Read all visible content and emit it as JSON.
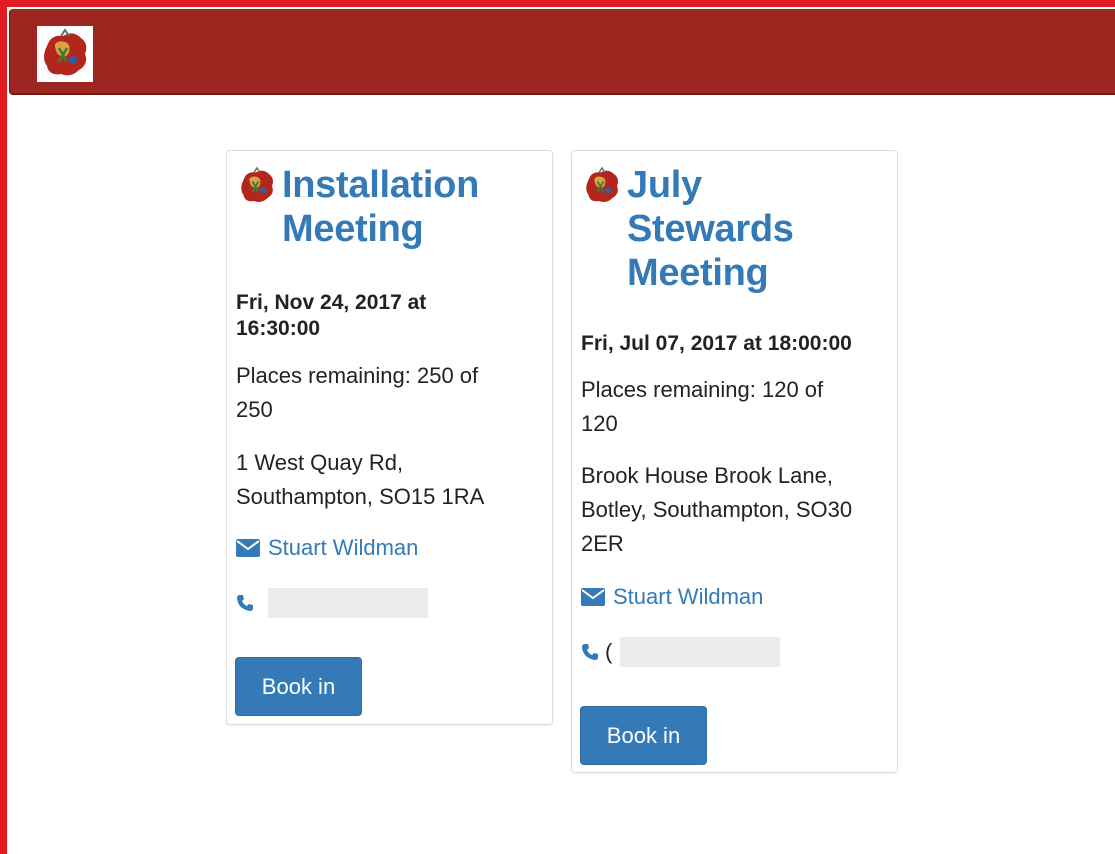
{
  "brand": {
    "logo_icon": "lodge-crest-icon"
  },
  "colors": {
    "navbar": "#9e2620",
    "accent": "#337ab7",
    "frame": "#e31b23"
  },
  "events": [
    {
      "title_line1": "Installation",
      "title_line2": "Meeting",
      "title_line3": "",
      "date_line1": "Fri, Nov 24, 2017 at",
      "date_line2": "16:30:00",
      "places_line1": "Places remaining: 250 of",
      "places_line2": "250",
      "address_line1": "1 West Quay Rd,",
      "address_line2": "Southampton, SO15 1RA",
      "address_line3": "",
      "contact_name": "Stuart Wildman",
      "phone_prefix": "",
      "book_label": "Book in"
    },
    {
      "title_line1": "July",
      "title_line2": "Stewards",
      "title_line3": "Meeting",
      "date_line1": "Fri, Jul 07, 2017 at 18:00:00",
      "date_line2": "",
      "places_line1": "Places remaining: 120 of",
      "places_line2": "120",
      "address_line1": "Brook House Brook Lane,",
      "address_line2": "Botley, Southampton, SO30",
      "address_line3": "2ER",
      "contact_name": "Stuart Wildman",
      "phone_prefix": "(",
      "book_label": "Book in"
    }
  ]
}
